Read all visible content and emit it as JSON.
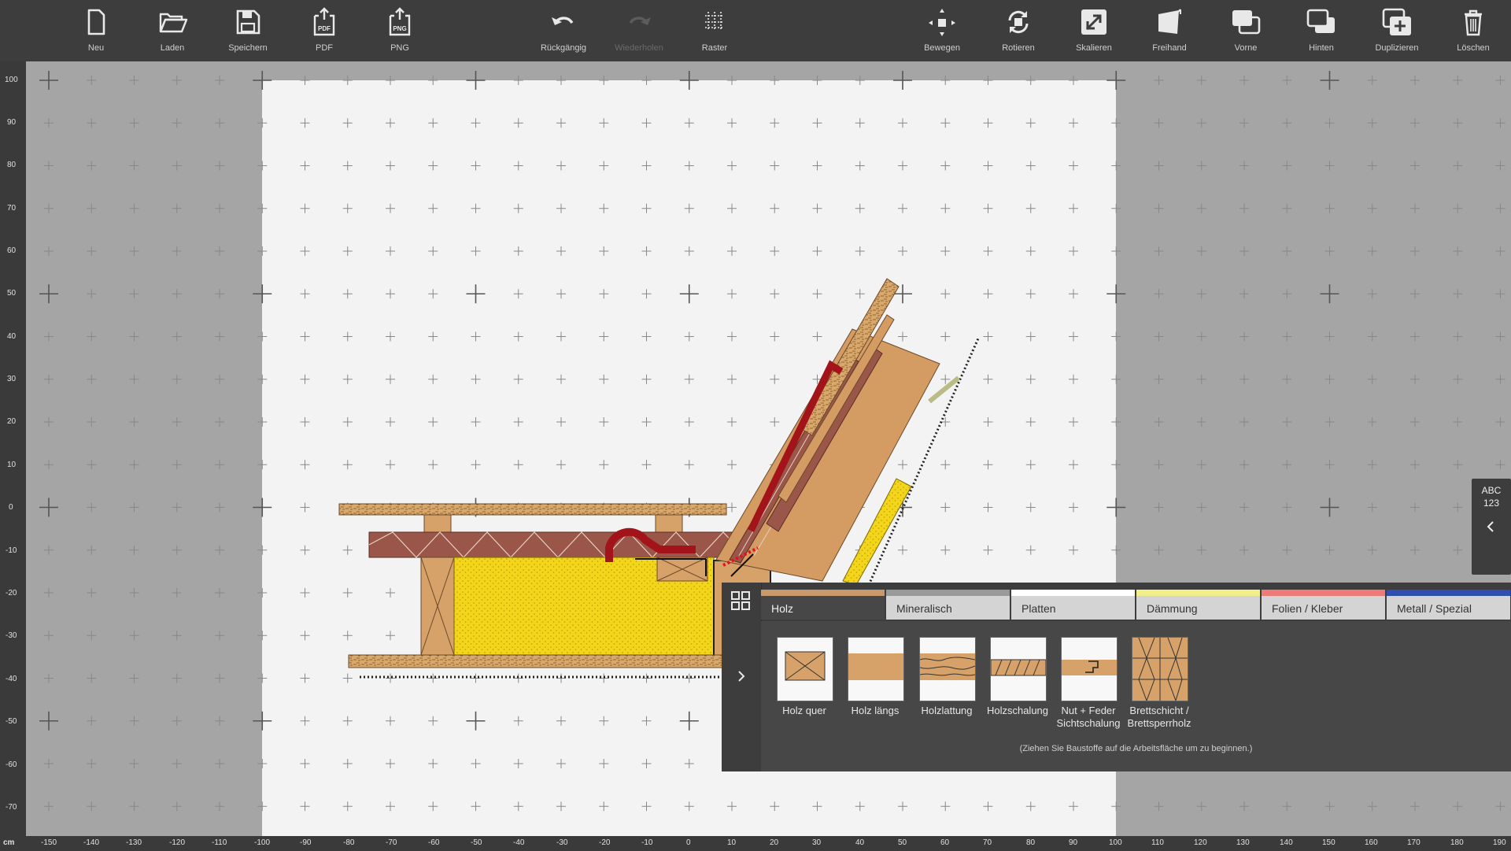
{
  "toolbar": {
    "new": "Neu",
    "load": "Laden",
    "save": "Speichern",
    "pdf": "PDF",
    "png": "PNG",
    "undo": "Rückgängig",
    "redo": "Wiederholen",
    "grid": "Raster",
    "move": "Bewegen",
    "rotate": "Rotieren",
    "scale": "Skalieren",
    "freehand": "Freihand",
    "front": "Vorne",
    "back": "Hinten",
    "duplicate": "Duplizieren",
    "delete": "Löschen"
  },
  "ruler": {
    "unit": "cm",
    "vertical": [
      "100",
      "90",
      "80",
      "70",
      "60",
      "50",
      "40",
      "30",
      "20",
      "10",
      "0",
      "-10",
      "-20",
      "-30",
      "-40",
      "-50",
      "-60",
      "-70"
    ],
    "horizontal": [
      "-150",
      "-140",
      "-130",
      "-120",
      "-110",
      "-100",
      "-90",
      "-80",
      "-70",
      "-60",
      "-50",
      "-40",
      "-30",
      "-20",
      "-10",
      "0",
      "10",
      "20",
      "30",
      "40",
      "50",
      "60",
      "70",
      "80",
      "90",
      "100",
      "110",
      "120",
      "130",
      "140",
      "150",
      "160",
      "170",
      "180",
      "190"
    ]
  },
  "sidetab": {
    "line1": "ABC",
    "line2": "123"
  },
  "materials": {
    "tabs": [
      {
        "label": "Holz",
        "color": "#c8996b"
      },
      {
        "label": "Mineralisch",
        "color": "#9a9a9a"
      },
      {
        "label": "Platten",
        "color": "#ffffff"
      },
      {
        "label": "Dämmung",
        "color": "#f2ef8a"
      },
      {
        "label": "Folien / Kleber",
        "color": "#ef7a7a"
      },
      {
        "label": "Metall / Spezial",
        "color": "#2f4fb0"
      }
    ],
    "tiles": [
      {
        "line1": "Holz quer",
        "line2": ""
      },
      {
        "line1": "Holz längs",
        "line2": ""
      },
      {
        "line1": "Holzlattung",
        "line2": ""
      },
      {
        "line1": "Holzschalung",
        "line2": ""
      },
      {
        "line1": "Nut + Feder",
        "line2": "Sichtschalung"
      },
      {
        "line1": "Brettschicht /",
        "line2": "Brettsperrholz"
      }
    ],
    "hint": "(Ziehen Sie Baustoffe auf die Arbeitsfläche um zu beginnen.)"
  }
}
